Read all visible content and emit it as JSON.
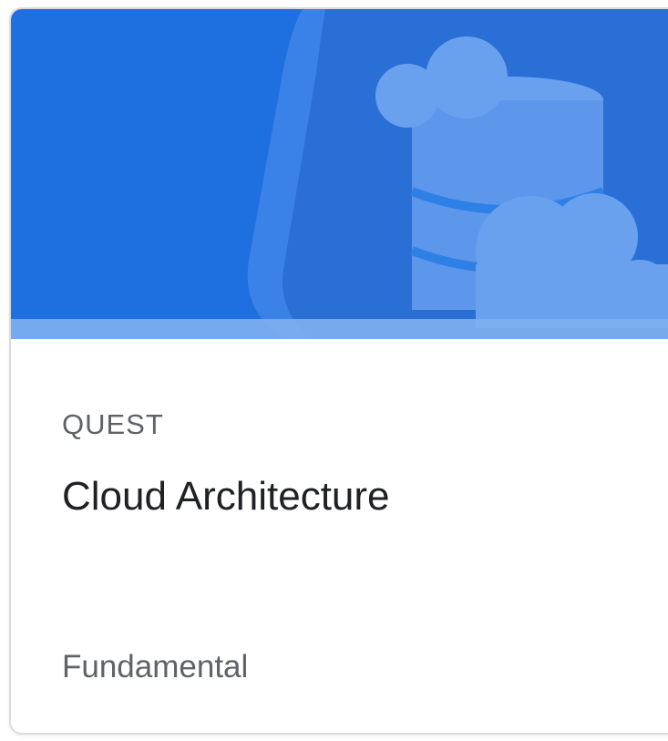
{
  "card": {
    "type_label": "QUEST",
    "title": "Cloud Architecture",
    "level": "Fundamental",
    "banner_icon": "cloud-database-icon",
    "colors": {
      "banner": "#1e6fe0",
      "banner_shape": "#3f86e8",
      "icon_fill": "#6aa1ef",
      "icon_dark": "#2a6fd6",
      "stripe": "#7fb0f0",
      "label_text": "#5f6368",
      "title_text": "#202124"
    }
  }
}
